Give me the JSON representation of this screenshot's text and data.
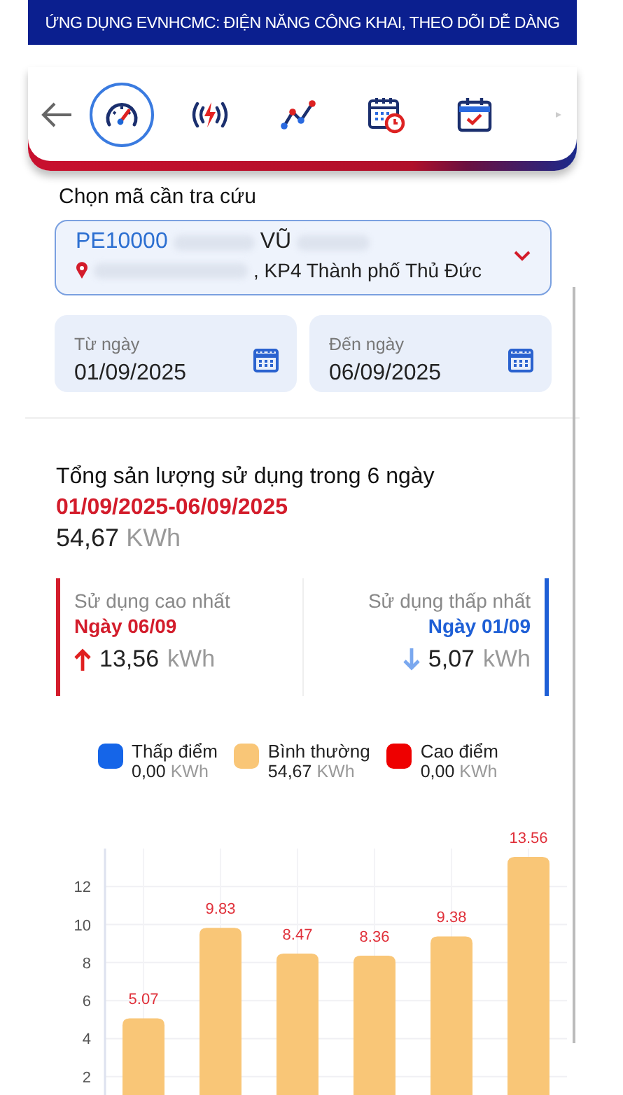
{
  "banner": {
    "title": "ỨNG DỤNG EVNHCMC: ĐIỆN NĂNG CÔNG KHAI, THEO DÕI DỄ DÀNG"
  },
  "nav": {
    "items": [
      {
        "kind": "gauge",
        "selected": true
      },
      {
        "kind": "power",
        "selected": false
      },
      {
        "kind": "trend",
        "selected": false
      },
      {
        "kind": "schedule",
        "selected": false
      },
      {
        "kind": "calendar",
        "selected": false
      }
    ]
  },
  "lookup": {
    "label": "Chọn mã cần tra cứu",
    "code": "PE10000",
    "name": "VŨ",
    "address": ", KP4 Thành phố Thủ Đức"
  },
  "dates": [
    {
      "label": "Từ ngày",
      "value": "01/09/2025"
    },
    {
      "label": "Đến ngày",
      "value": "06/09/2025"
    }
  ],
  "summary": {
    "title": "Tổng sản lượng sử dụng trong 6 ngày",
    "range": "01/09/2025-06/09/2025",
    "total": "54,67",
    "unit": "KWh"
  },
  "extremes": [
    {
      "kind": "high",
      "label": "Sử dụng cao nhất",
      "day": "Ngày 06/09",
      "value": "13,56",
      "unit": "kWh"
    },
    {
      "kind": "low",
      "label": "Sử dụng thấp nhất",
      "day": "Ngày 01/09",
      "value": "5,07",
      "unit": "kWh"
    }
  ],
  "legend": [
    {
      "name": "Thấp điểm",
      "value": "0,00",
      "unit": "KWh",
      "color": "#1565e8"
    },
    {
      "name": "Bình thường",
      "value": "54,67",
      "unit": "KWh",
      "color": "#f9c677"
    },
    {
      "name": "Cao điểm",
      "value": "0,00",
      "unit": "KWh",
      "color": "#ee0000"
    }
  ],
  "chart": {
    "chart_data": {
      "type": "bar",
      "grid": true,
      "ylim": [
        0,
        14
      ],
      "yticks": [
        2,
        4,
        6,
        8,
        10,
        12
      ],
      "data_labels": true,
      "series": [
        {
          "color": "#f9c677",
          "values": [
            5.07,
            9.83,
            8.47,
            8.36,
            9.38,
            13.56
          ]
        }
      ]
    }
  }
}
